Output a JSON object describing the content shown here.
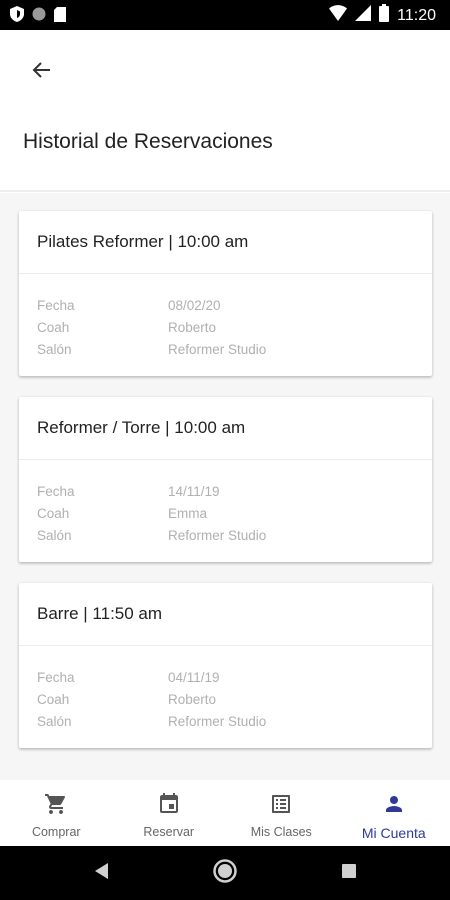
{
  "status_bar": {
    "time": "11:20",
    "icons": [
      "shield-icon",
      "circle-icon",
      "sd-card-icon",
      "wifi-icon",
      "signal-icon",
      "battery-icon"
    ]
  },
  "header": {
    "back_icon": "arrow-left-icon",
    "title": "Historial de Reservaciones"
  },
  "labels": {
    "date": "Fecha",
    "coach": "Coah",
    "room": "Salón"
  },
  "reservations": [
    {
      "title": "Pilates Reformer | 10:00 am",
      "date": "08/02/20",
      "coach": "Roberto",
      "room": "Reformer Studio"
    },
    {
      "title": "Reformer / Torre | 10:00 am",
      "date": "14/11/19",
      "coach": "Emma",
      "room": "Reformer Studio"
    },
    {
      "title": "Barre | 11:50 am",
      "date": "04/11/19",
      "coach": "Roberto",
      "room": "Reformer Studio"
    }
  ],
  "bottom_nav": {
    "items": [
      {
        "label": "Comprar",
        "icon": "cart-icon"
      },
      {
        "label": "Reservar",
        "icon": "calendar-icon"
      },
      {
        "label": "Mis Clases",
        "icon": "list-icon"
      },
      {
        "label": "Mi Cuenta",
        "icon": "person-icon",
        "active": true
      }
    ]
  },
  "colors": {
    "accent": "#2d3a9a",
    "nav_inactive": "#555555",
    "muted_text": "#b0b0b0"
  },
  "system_nav": {
    "icons": [
      "back-triangle-icon",
      "home-circle-icon",
      "recents-square-icon"
    ]
  }
}
